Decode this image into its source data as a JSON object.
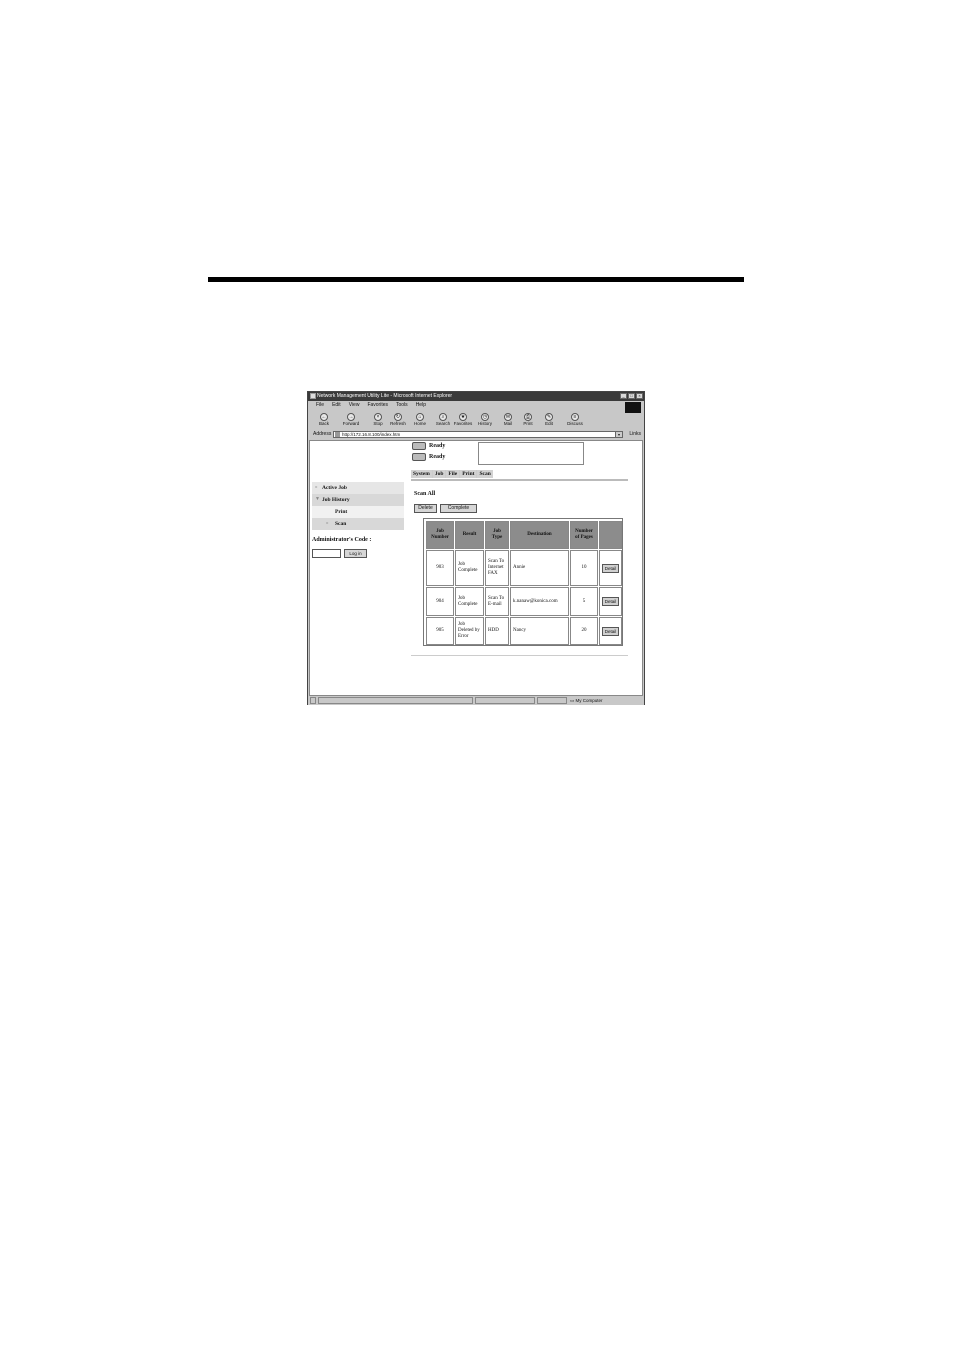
{
  "window": {
    "title": "Network Management Utility Lite - Microsoft Internet Explorer",
    "controls": [
      "_",
      "□",
      "×"
    ]
  },
  "menu": [
    "File",
    "Edit",
    "View",
    "Favorites",
    "Tools",
    "Help"
  ],
  "toolbar": [
    {
      "label": "Back",
      "icon": "back-arrow-icon"
    },
    {
      "label": "Forward",
      "icon": "forward-arrow-icon"
    },
    {
      "label": "Stop",
      "icon": "stop-icon"
    },
    {
      "label": "Refresh",
      "icon": "refresh-icon"
    },
    {
      "label": "Home",
      "icon": "home-icon"
    },
    {
      "label": "Search",
      "icon": "search-icon"
    },
    {
      "label": "Favorites",
      "icon": "favorites-icon"
    },
    {
      "label": "History",
      "icon": "history-icon"
    },
    {
      "label": "Mail",
      "icon": "mail-icon"
    },
    {
      "label": "Print",
      "icon": "print-icon"
    },
    {
      "label": "Edit",
      "icon": "edit-icon"
    },
    {
      "label": "Discuss",
      "icon": "discuss-icon"
    }
  ],
  "address": {
    "label": "Address",
    "url": "http://172.16.8.100/index.htm",
    "links": "Links"
  },
  "status": {
    "printer": "Ready",
    "scanner": "Ready"
  },
  "tabs": [
    "System",
    "Job",
    "File",
    "Print",
    "Scan"
  ],
  "sidebar": {
    "items": [
      {
        "label": "Active Job",
        "marker": "»"
      },
      {
        "label": "Job History",
        "marker": "▼"
      },
      {
        "label": "Print",
        "marker": ""
      },
      {
        "label": "Scan",
        "marker": "»"
      }
    ],
    "admin_label": "Administrator's Code :",
    "login_label": "Log in"
  },
  "main": {
    "heading": "Scan All",
    "delete_label": "Delete",
    "complete_label": "Complete",
    "table": {
      "headers": [
        "Job Number",
        "Result",
        "Job Type",
        "Destination",
        "Number of Pages",
        ""
      ],
      "rows": [
        {
          "job_number": "903",
          "result": "Job Complete",
          "job_type": "Scan To Internet FAX",
          "destination": "Annie",
          "pages": "10",
          "action": "Detail"
        },
        {
          "job_number": "904",
          "result": "Job Complete",
          "job_type": "Scan To E-mail",
          "destination": "k.nanaw@konica.com",
          "pages": "5",
          "action": "Detail"
        },
        {
          "job_number": "905",
          "result": "Job Deleted by Error",
          "job_type": "HDD",
          "destination": "Nancy",
          "pages": "20",
          "action": "Detail"
        }
      ]
    }
  },
  "statusbar": {
    "zone": "My Computer"
  }
}
